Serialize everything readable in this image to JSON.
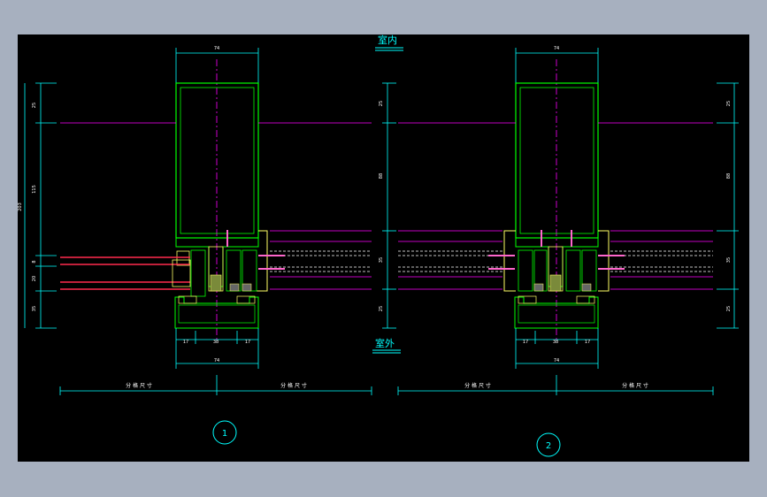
{
  "labels": {
    "interior": "室内",
    "exterior": "室外",
    "grid_dimension": "分 格 尺 寸",
    "width_dim": "74",
    "sub_dim_left": "17",
    "sub_dim_mid": "38",
    "sub_dim_right": "17",
    "vertical_dims_left": [
      "25",
      "115",
      "8",
      "20",
      "35"
    ],
    "total_height": "203",
    "vertical_dims_right": [
      "25",
      "88",
      "35",
      "25"
    ],
    "detail_1": "1",
    "detail_2": "2"
  },
  "colors": {
    "background": "#000000",
    "frame": "#a7b0bf",
    "dimension": "#00ffff",
    "centerline": "#ff00ff",
    "profile": "#00ff00",
    "glass": "#ff2a4d",
    "hardware": "#ffff66",
    "bolt": "#ff66cc",
    "white": "#ffffff"
  }
}
